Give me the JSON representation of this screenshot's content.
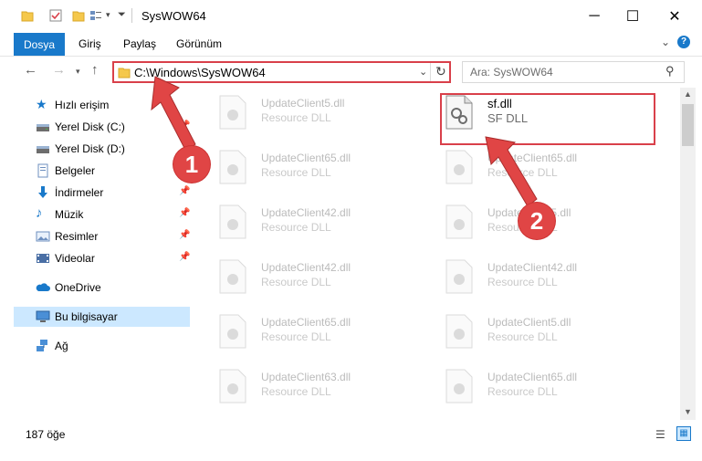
{
  "window": {
    "title": "SysWOW64"
  },
  "ribbon": {
    "tabs": [
      "Dosya",
      "Giriş",
      "Paylaş",
      "Görünüm"
    ]
  },
  "address": {
    "path": "C:\\Windows\\SysWOW64"
  },
  "search": {
    "placeholder": "Ara: SysWOW64"
  },
  "sidebar": {
    "items": [
      {
        "label": "Hızlı erişim",
        "icon": "star-icon"
      },
      {
        "label": "Yerel Disk (C:)",
        "icon": "drive-icon"
      },
      {
        "label": "Yerel Disk (D:)",
        "icon": "drive-icon"
      },
      {
        "label": "Belgeler",
        "icon": "documents-icon"
      },
      {
        "label": "İndirmeler",
        "icon": "download-icon"
      },
      {
        "label": "Müzik",
        "icon": "music-icon"
      },
      {
        "label": "Resimler",
        "icon": "pictures-icon"
      },
      {
        "label": "Videolar",
        "icon": "video-icon"
      },
      {
        "label": "OneDrive",
        "icon": "cloud-icon"
      },
      {
        "label": "Bu bilgisayar",
        "icon": "computer-icon"
      },
      {
        "label": "Ağ",
        "icon": "network-icon"
      }
    ]
  },
  "files": {
    "left": [
      {
        "name": "UpdateClient5.dll",
        "type": "Resource DLL"
      },
      {
        "name": "UpdateClient65.dll",
        "type": "Resource DLL"
      },
      {
        "name": "UpdateClient42.dll",
        "type": "Resource DLL"
      },
      {
        "name": "UpdateClient42.dll",
        "type": "Resource DLL"
      },
      {
        "name": "UpdateClient65.dll",
        "type": "Resource DLL"
      },
      {
        "name": "UpdateClient63.dll",
        "type": "Resource DLL"
      }
    ],
    "right": [
      {
        "name": "sf.dll",
        "type": "SF DLL"
      },
      {
        "name": "UpdateClient65.dll",
        "type": "Resource DLL"
      },
      {
        "name": "UpdateClient5.dll",
        "type": "Resource DLL"
      },
      {
        "name": "UpdateClient42.dll",
        "type": "Resource DLL"
      },
      {
        "name": "UpdateClient5.dll",
        "type": "Resource DLL"
      },
      {
        "name": "UpdateClient65.dll",
        "type": "Resource DLL"
      }
    ]
  },
  "status": {
    "count": "187 öğe"
  },
  "callouts": {
    "one": "1",
    "two": "2"
  },
  "colors": {
    "accent": "#1979ca",
    "highlight": "#d9404a",
    "selection": "#cce8ff"
  }
}
